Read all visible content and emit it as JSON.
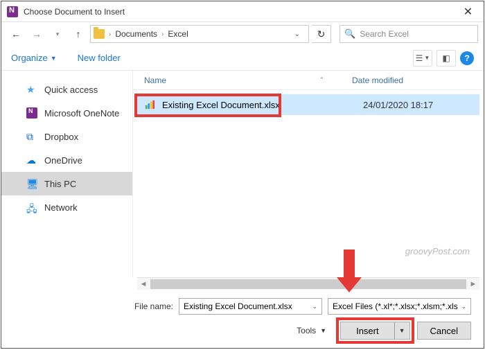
{
  "title": "Choose Document to Insert",
  "breadcrumbs": {
    "root": "Documents",
    "folder": "Excel"
  },
  "search": {
    "placeholder": "Search Excel"
  },
  "toolbar": {
    "organize": "Organize",
    "new_folder": "New folder"
  },
  "sidebar": {
    "items": [
      {
        "label": "Quick access"
      },
      {
        "label": "Microsoft OneNote"
      },
      {
        "label": "Dropbox"
      },
      {
        "label": "OneDrive"
      },
      {
        "label": "This PC"
      },
      {
        "label": "Network"
      }
    ]
  },
  "columns": {
    "name": "Name",
    "date": "Date modified"
  },
  "files": [
    {
      "name": "Existing Excel Document.xlsx",
      "date": "24/01/2020 18:17"
    }
  ],
  "watermark": "groovyPost.com",
  "bottom": {
    "filename_label": "File name:",
    "filename_value": "Existing Excel Document.xlsx",
    "filter": "Excel Files (*.xl*;*.xlsx;*.xlsm;*.xls",
    "tools": "Tools",
    "insert": "Insert",
    "cancel": "Cancel"
  }
}
